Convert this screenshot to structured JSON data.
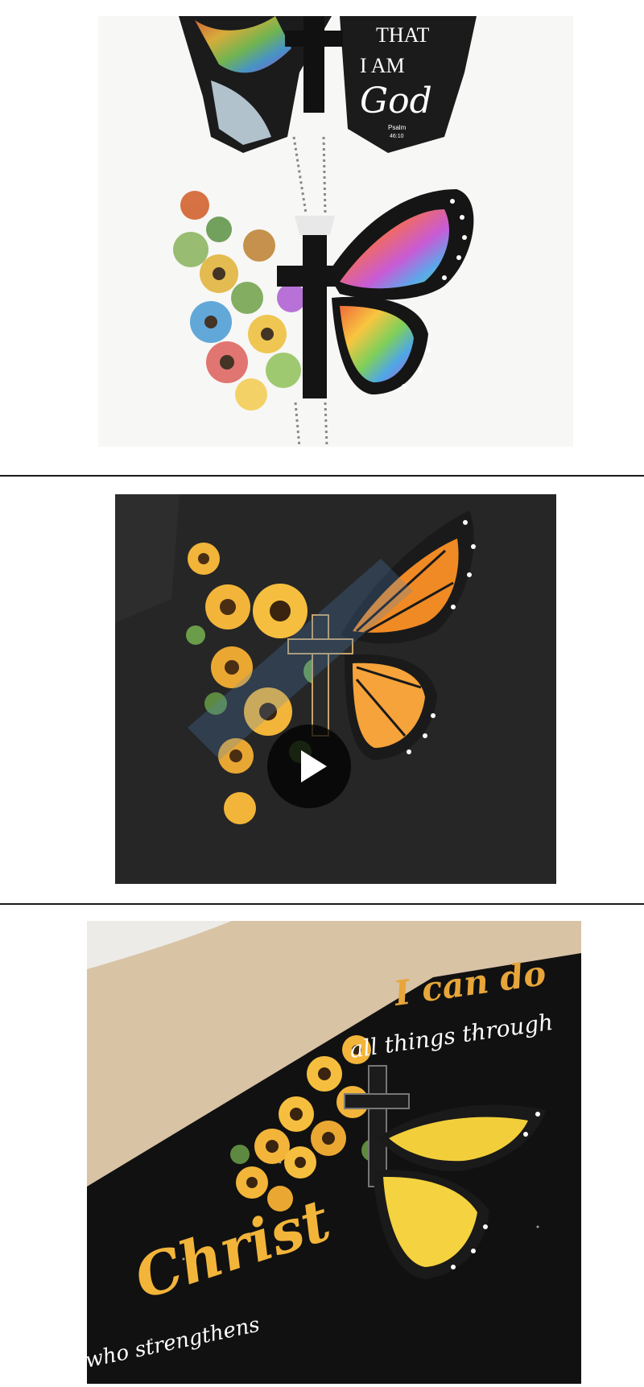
{
  "panels": [
    {
      "name": "necklace-butterfly-cross",
      "caption_lines": [
        "THAT",
        "I AM",
        "God",
        "Psalm",
        "46:10"
      ]
    },
    {
      "name": "tshirt-sunflower-butterfly",
      "has_play_button": true,
      "play_icon": "play-icon"
    },
    {
      "name": "beach-towel-sunflower-butterfly",
      "text_line1": "I can do",
      "text_line2": "all things through",
      "text_line3": "Christ",
      "text_line4": "who strengthens"
    }
  ],
  "colors": {
    "divider": "#1a1a1a",
    "shirt": "#262626",
    "towel": "#111111",
    "sand": "#d9c3a5",
    "gold": "#f2b53a",
    "orange": "#f08a24"
  }
}
